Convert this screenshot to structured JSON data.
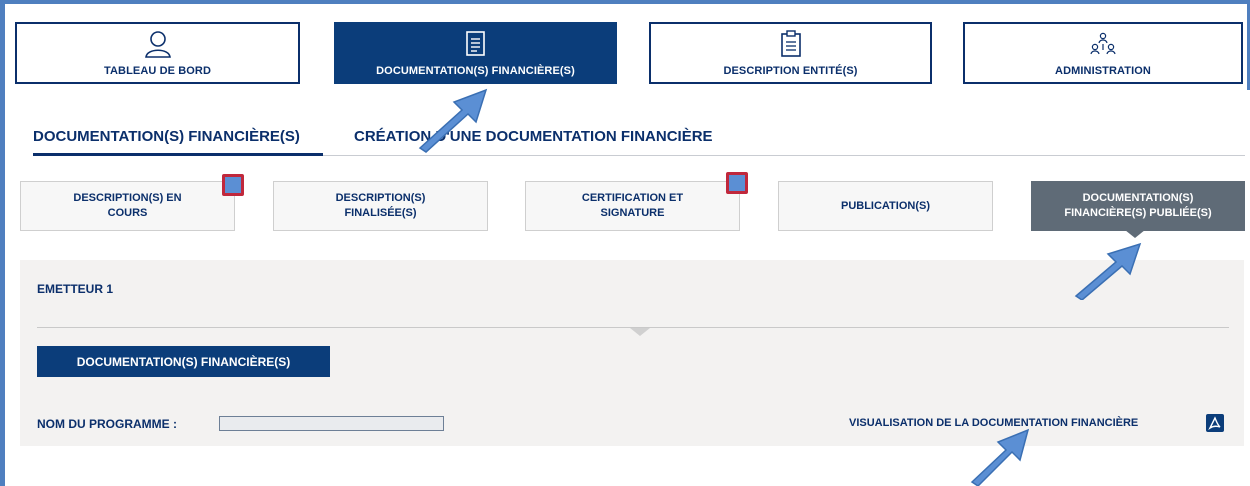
{
  "nav": {
    "items": [
      {
        "label": "TABLEAU DE BORD",
        "icon": "user-icon"
      },
      {
        "label": "DOCUMENTATION(S) FINANCIÈRE(S)",
        "icon": "document-icon"
      },
      {
        "label": "DESCRIPTION ENTITÉ(S)",
        "icon": "clipboard-icon"
      },
      {
        "label": "ADMINISTRATION",
        "icon": "org-chart-icon"
      }
    ],
    "active_index": 1
  },
  "subtabs": {
    "items": [
      {
        "label": "DOCUMENTATION(S) FINANCIÈRE(S)",
        "active": true
      },
      {
        "label": "CRÉATION D'UNE DOCUMENTATION FINANCIÈRE",
        "active": false
      }
    ]
  },
  "steps": {
    "items": [
      {
        "line1": "DESCRIPTION(S) EN",
        "line2": "COURS",
        "badge": true
      },
      {
        "line1": "DESCRIPTION(S)",
        "line2": "FINALISÉE(S)",
        "badge": false
      },
      {
        "line1": "CERTIFICATION ET",
        "line2": "SIGNATURE",
        "badge": true
      },
      {
        "line1": "PUBLICATION(S)",
        "line2": "",
        "badge": false
      },
      {
        "line1": "DOCUMENTATION(S)",
        "line2": "FINANCIÈRE(S) PUBLIÉE(S)",
        "badge": false,
        "active": true
      }
    ]
  },
  "panel": {
    "title": "EMETTEUR 1",
    "doc_button": "DOCUMENTATION(S) FINANCIÈRE(S)",
    "program_label": "NOM DU PROGRAMME :",
    "program_value": "",
    "viz_link": "VISUALISATION DE LA DOCUMENTATION FINANCIÈRE",
    "viz_icon": "pdf-icon"
  },
  "colors": {
    "navy": "#0b3d7a",
    "text": "#0b2f6b",
    "active_step": "#5f6b77",
    "panel_bg": "#f3f2f1",
    "badge_fill": "#5b8fd4",
    "badge_border": "#c0283c",
    "annotation_arrow": "#5b8fd4"
  }
}
